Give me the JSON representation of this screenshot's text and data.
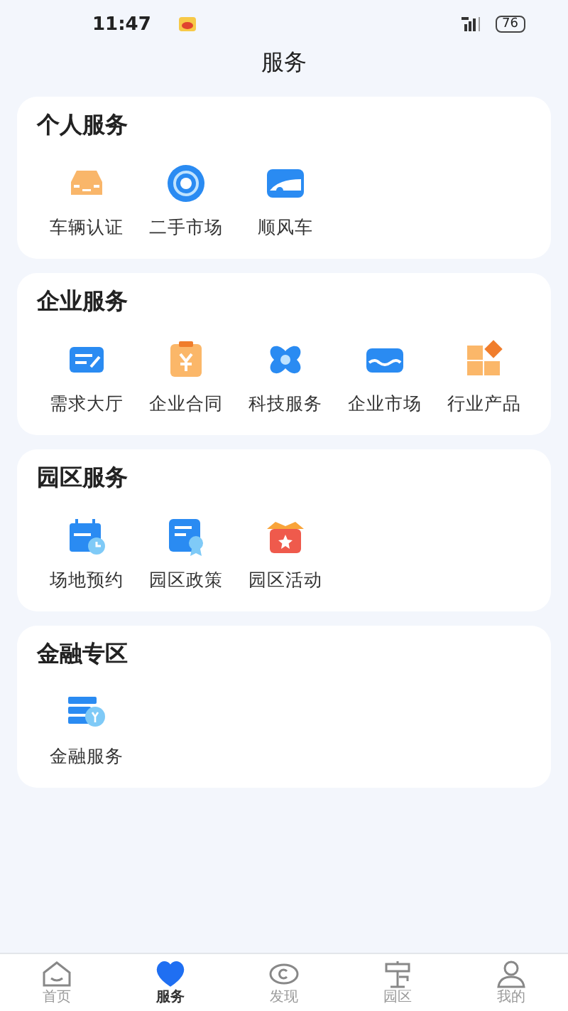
{
  "status_bar": {
    "time": "11:47",
    "battery": "76"
  },
  "header": {
    "title": "服务"
  },
  "sections": [
    {
      "title": "个人服务",
      "items": [
        {
          "label": "车辆认证"
        },
        {
          "label": "二手市场"
        },
        {
          "label": "顺风车"
        }
      ]
    },
    {
      "title": "企业服务",
      "items": [
        {
          "label": "需求大厅"
        },
        {
          "label": "企业合同"
        },
        {
          "label": "科技服务"
        },
        {
          "label": "企业市场"
        },
        {
          "label": "行业产品"
        }
      ]
    },
    {
      "title": "园区服务",
      "items": [
        {
          "label": "场地预约"
        },
        {
          "label": "园区政策"
        },
        {
          "label": "园区活动"
        }
      ]
    },
    {
      "title": "金融专区",
      "items": [
        {
          "label": "金融服务"
        }
      ]
    }
  ],
  "tab_bar": [
    {
      "label": "首页",
      "selected": false
    },
    {
      "label": "服务",
      "selected": true
    },
    {
      "label": "发现",
      "selected": false
    },
    {
      "label": "园区",
      "selected": false
    },
    {
      "label": "我的",
      "selected": false
    }
  ]
}
